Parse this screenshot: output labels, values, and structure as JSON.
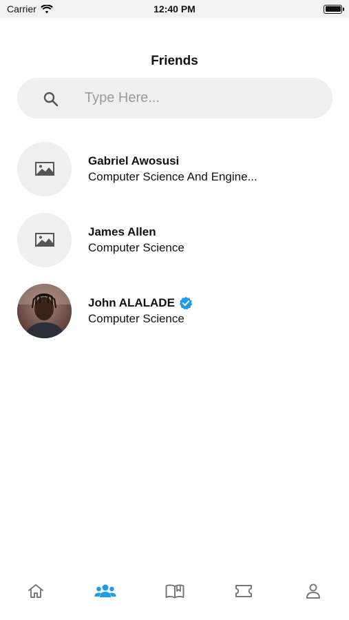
{
  "status_bar": {
    "carrier": "Carrier",
    "time": "12:40 PM"
  },
  "header": {
    "title": "Friends"
  },
  "search": {
    "placeholder": "Type Here...",
    "value": ""
  },
  "friends": [
    {
      "name": "Gabriel Awosusi",
      "subtitle": "Computer Science And Engine...",
      "avatar": "placeholder-image-icon",
      "verified": false
    },
    {
      "name": "James Allen",
      "subtitle": "Computer Science",
      "avatar": "placeholder-image-icon",
      "verified": false
    },
    {
      "name": "John ALALADE",
      "subtitle": "Computer Science",
      "avatar": "profile-photo",
      "verified": true
    }
  ],
  "tabbar": {
    "tabs": [
      {
        "icon": "home-icon",
        "active": false
      },
      {
        "icon": "friends-icon",
        "active": true
      },
      {
        "icon": "book-icon",
        "active": false
      },
      {
        "icon": "ticket-icon",
        "active": false
      },
      {
        "icon": "profile-icon",
        "active": false
      }
    ],
    "active_color": "#1e9be9",
    "inactive_color": "#777777"
  }
}
